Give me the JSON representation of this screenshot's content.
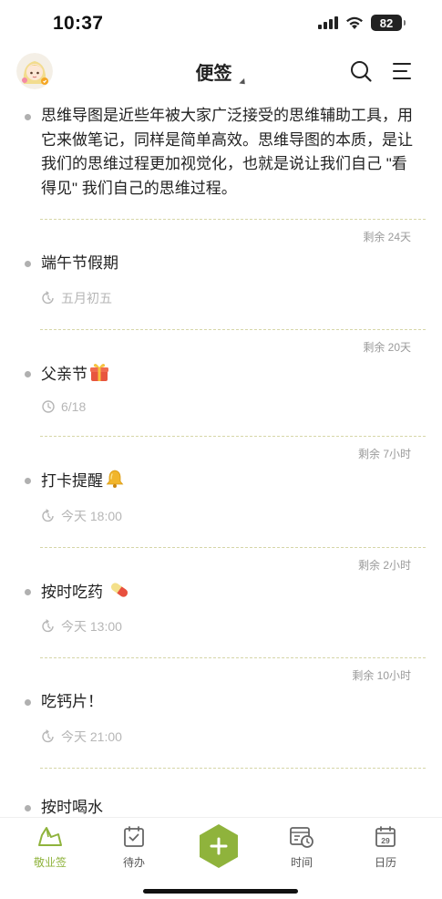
{
  "status_bar": {
    "time": "10:37",
    "battery": "82"
  },
  "header": {
    "title": "便签"
  },
  "notes": [
    {
      "text": "思维导图是近些年被大家广泛接受的思维辅助工具，用它来做笔记，同样是简单高效。思维导图的本质，是让我们的思维过程更加视觉化，也就是说让我们自己 \"看得见\" 我们自己的思维过程。",
      "remaining": "剩余 24天"
    },
    {
      "text": "端午节假期",
      "reminder": "五月初五",
      "reminder_icon": "recurring-alarm-icon",
      "remaining": "剩余 20天"
    },
    {
      "text": "父亲节",
      "emoji": "gift-icon",
      "reminder": "6/18",
      "reminder_icon": "clock-icon",
      "remaining": "剩余 7小时"
    },
    {
      "text": "打卡提醒",
      "emoji": "bell-icon",
      "reminder": "今天 18:00",
      "reminder_icon": "recurring-alarm-icon",
      "remaining": "剩余 2小时"
    },
    {
      "text": "按时吃药",
      "emoji": "pill-icon",
      "reminder": "今天 13:00",
      "reminder_icon": "recurring-alarm-icon",
      "remaining": "剩余 10小时"
    },
    {
      "text": "吃钙片！",
      "reminder": "今天 21:00",
      "reminder_icon": "recurring-alarm-icon"
    },
    {
      "text": "按时喝水"
    }
  ],
  "tabs": [
    {
      "label": "敬业签",
      "icon": "home-tab-icon",
      "active": true
    },
    {
      "label": "待办",
      "icon": "todo-icon"
    },
    {
      "label": "时间",
      "icon": "time-icon"
    },
    {
      "label": "日历",
      "icon": "calendar-icon",
      "day": "29"
    }
  ],
  "colors": {
    "accent": "#8fb33c",
    "divider": "#d6d6a8",
    "bullet": "#b0b0b0"
  }
}
